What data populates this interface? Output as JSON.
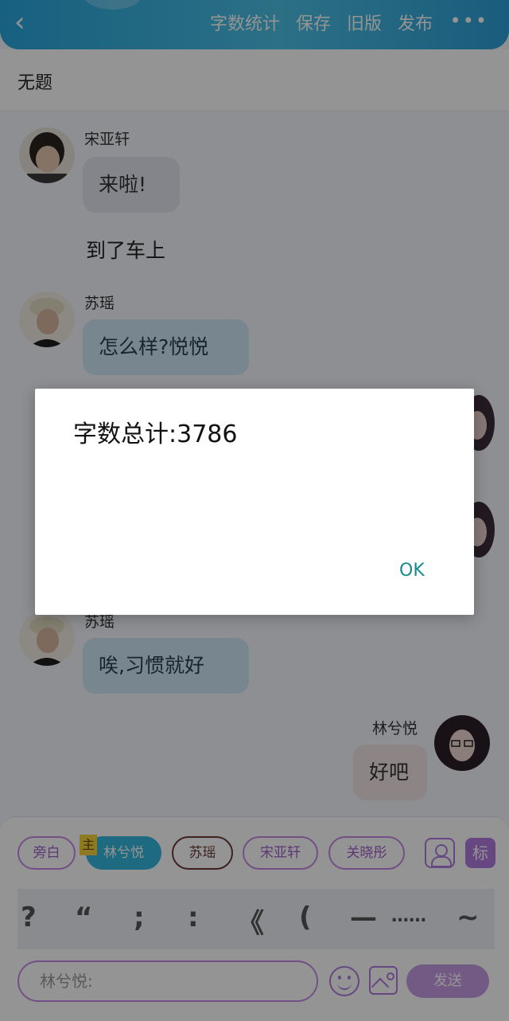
{
  "header": {
    "back_icon": "‹",
    "actions": [
      "字数统计",
      "保存",
      "旧版",
      "发布"
    ],
    "more_icon": "•••"
  },
  "doc_title": "无题",
  "messages": [
    {
      "speaker": "宋亚轩",
      "text": "来啦!",
      "side": "left",
      "style": "grey"
    },
    {
      "narration": "到了车上"
    },
    {
      "speaker": "苏瑶",
      "text": "怎么样?悦悦",
      "side": "left",
      "style": "blue"
    },
    {
      "speaker": "苏瑶",
      "text": "唉,习惯就好",
      "side": "left",
      "style": "blue"
    },
    {
      "speaker": "林兮悦",
      "text": "好吧",
      "side": "right",
      "style": "pink"
    }
  ],
  "roles": {
    "items": [
      "旁白",
      "林兮悦",
      "苏瑶",
      "宋亚轩",
      "关晓彤"
    ],
    "main_tag": "主",
    "active_index": 1,
    "mark_label": "标"
  },
  "punctuation": [
    "?",
    "“",
    ";",
    ":",
    "《",
    "(",
    "—",
    "……",
    "~"
  ],
  "composer": {
    "placeholder": "林兮悦:",
    "send_label": "发送"
  },
  "dialog": {
    "message": "字数总计:3786",
    "ok_label": "OK"
  },
  "colors": {
    "header": "#2fa9e0",
    "accent_purple": "#b17ae0",
    "active_chip": "#35b7dd",
    "ok_text": "#178a8e"
  }
}
